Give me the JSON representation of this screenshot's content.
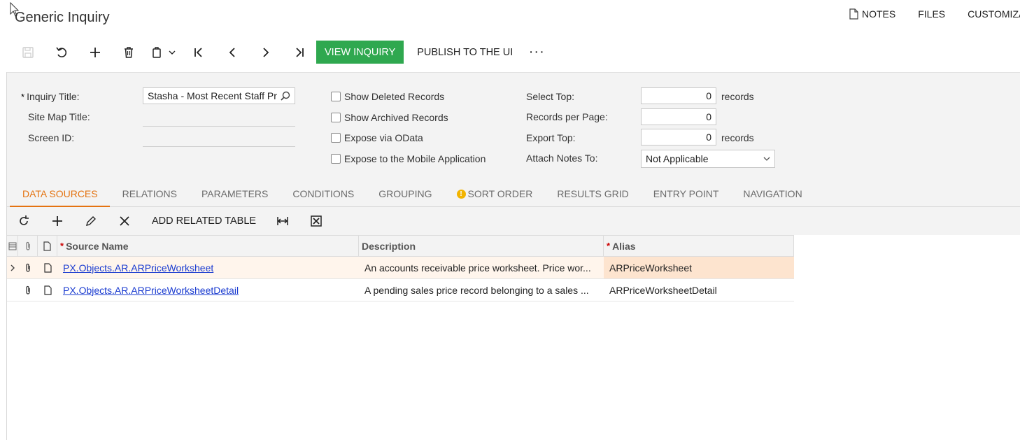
{
  "page": {
    "title": "Generic Inquiry"
  },
  "top_links": [
    {
      "label": "NOTES",
      "icon": "document-icon"
    },
    {
      "label": "FILES"
    },
    {
      "label": "CUSTOMIZAT"
    }
  ],
  "toolbar": {
    "view_inquiry": "VIEW INQUIRY",
    "publish": "PUBLISH TO THE UI",
    "more": "···"
  },
  "form": {
    "inquiry_title_label": "Inquiry Title:",
    "inquiry_title_value": "Stasha - Most Recent Staff Pr",
    "site_map_title_label": "Site Map Title:",
    "screen_id_label": "Screen ID:",
    "checkboxes": [
      {
        "label": "Show Deleted Records",
        "checked": false
      },
      {
        "label": "Show Archived Records",
        "checked": false
      },
      {
        "label": "Expose via OData",
        "checked": false
      },
      {
        "label": "Expose to the Mobile Application",
        "checked": false
      }
    ],
    "select_top_label": "Select Top:",
    "select_top_value": "0",
    "records_per_page_label": "Records per Page:",
    "records_per_page_value": "0",
    "export_top_label": "Export Top:",
    "export_top_value": "0",
    "records_suffix": "records",
    "attach_notes_label": "Attach Notes To:",
    "attach_notes_value": "Not Applicable"
  },
  "tabs": [
    {
      "label": "DATA SOURCES",
      "active": true
    },
    {
      "label": "RELATIONS"
    },
    {
      "label": "PARAMETERS"
    },
    {
      "label": "CONDITIONS"
    },
    {
      "label": "GROUPING"
    },
    {
      "label": "SORT ORDER",
      "warning": true
    },
    {
      "label": "RESULTS GRID"
    },
    {
      "label": "ENTRY POINT"
    },
    {
      "label": "NAVIGATION"
    }
  ],
  "grid_toolbar": {
    "add_related": "ADD RELATED TABLE"
  },
  "grid": {
    "headers": {
      "source_name": "Source Name",
      "description": "Description",
      "alias": "Alias"
    },
    "rows": [
      {
        "source_name": "PX.Objects.AR.ARPriceWorksheet",
        "description": "An accounts receivable price worksheet. Price wor...",
        "alias": "ARPriceWorksheet"
      },
      {
        "source_name": "PX.Objects.AR.ARPriceWorksheetDetail",
        "description": "A pending sales price record belonging to a sales ...",
        "alias": "ARPriceWorksheetDetail"
      }
    ]
  },
  "colors": {
    "accent": "#e47311",
    "primary_button": "#2fa84f",
    "link": "#1a3bd0",
    "selected_row": "#fff5ec"
  }
}
